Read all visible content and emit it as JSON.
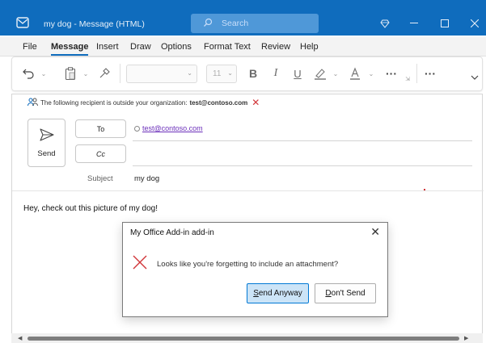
{
  "window": {
    "title": "my dog  -  Message (HTML)",
    "search_placeholder": "Search",
    "accent": "#0f6cbd"
  },
  "menu": {
    "tabs": [
      "File",
      "Message",
      "Insert",
      "Draw",
      "Options",
      "Format Text",
      "Review",
      "Help"
    ],
    "active": "Message"
  },
  "ribbon": {
    "font_size": "11",
    "icons": [
      "undo-icon",
      "paste-icon",
      "format-painter-icon",
      "bold-icon",
      "italic-icon",
      "underline-icon",
      "highlight-icon",
      "font-color-icon",
      "more-icon",
      "overflow-icon",
      "collapse-ribbon-icon"
    ]
  },
  "compose": {
    "warning_prefix": "The following recipient is outside your organization:",
    "warning_email": "test@contoso.com",
    "send_label": "Send",
    "to_label": "To",
    "cc_label": "Cc",
    "to_value": "test@contoso.com",
    "subject_label": "Subject",
    "subject_value": "my dog",
    "body": "Hey, check out this picture of my dog!"
  },
  "dialog": {
    "title": "My Office Add-in add-in",
    "message": "Looks like you're forgetting to include an attachment?",
    "send_anyway_accel": "S",
    "send_anyway_rest": "end Anyway",
    "dont_send_accel": "D",
    "dont_send_rest": "on't Send",
    "error_color": "#d13438"
  }
}
